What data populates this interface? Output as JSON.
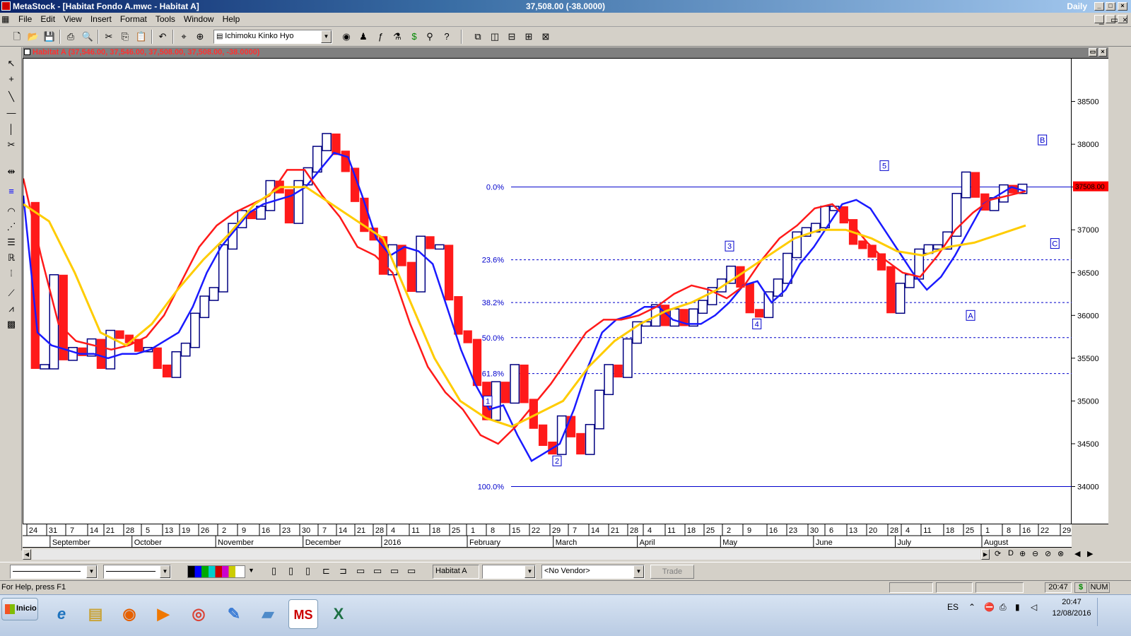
{
  "window": {
    "app_title": "MetaStock - [Habitat Fondo A.mwc - Habitat A]",
    "center_title": "37,508.00 (-38.0000)",
    "periodicity": "Daily"
  },
  "menu": [
    "File",
    "Edit",
    "View",
    "Insert",
    "Format",
    "Tools",
    "Window",
    "Help"
  ],
  "toolbar": {
    "indicator_combo": "Ichimoku Kinko Hyo"
  },
  "chart_header": "Habitat A (37,546.00, 37,546.00, 37,508.00, 37,508.00, -38.0000)",
  "chart_data": {
    "type": "bar",
    "security": "Habitat A",
    "last_price_label": "37508.00",
    "y_ticks": [
      34000,
      34500,
      35000,
      35500,
      36000,
      36500,
      37000,
      37500,
      38000,
      38500
    ],
    "fib_levels": [
      {
        "label": "0.0%",
        "value": 37500
      },
      {
        "label": "23.6%",
        "value": 36650
      },
      {
        "label": "38.2%",
        "value": 36150
      },
      {
        "label": "50.0%",
        "value": 35740
      },
      {
        "label": "61.8%",
        "value": 35320
      },
      {
        "label": "100.0%",
        "value": 34000
      }
    ],
    "wave_labels": [
      {
        "text": "1",
        "date": "2016-02-06",
        "value": 35000
      },
      {
        "text": "2",
        "date": "2016-02-29",
        "value": 34300
      },
      {
        "text": "3",
        "date": "2016-05-02",
        "value": 36810
      },
      {
        "text": "4",
        "date": "2016-05-11",
        "value": 35900
      },
      {
        "text": "5",
        "date": "2016-06-24",
        "value": 37750
      },
      {
        "text": "A",
        "date": "2016-07-25",
        "value": 36000
      },
      {
        "text": "B",
        "date": "2016-08-21",
        "value": 38050
      },
      {
        "text": "C",
        "date": "2016-08-25",
        "value": 36840
      }
    ],
    "x_day_ticks": [
      "24",
      "31",
      "7",
      "14",
      "21",
      "28",
      "5",
      "13",
      "19",
      "26",
      "2",
      "9",
      "16",
      "23",
      "30",
      "7",
      "14",
      "21",
      "28",
      "4",
      "11",
      "18",
      "25",
      "1",
      "8",
      "15",
      "22",
      "29",
      "7",
      "14",
      "21",
      "28",
      "4",
      "11",
      "18",
      "25",
      "2",
      "9",
      "16",
      "23",
      "30",
      "6",
      "13",
      "20",
      "28",
      "4",
      "11",
      "18",
      "25",
      "1",
      "8",
      "16",
      "22",
      "29"
    ],
    "x_month_ticks": [
      "September",
      "October",
      "November",
      "December",
      "2016",
      "February",
      "March",
      "April",
      "May",
      "June",
      "July",
      "August"
    ],
    "series": [
      {
        "name": "Price",
        "values": [
          37300,
          35400,
          35400,
          36450,
          35500,
          35600,
          35550,
          35700,
          35400,
          35800,
          35750,
          35700,
          35600,
          35600,
          35400,
          35300,
          35550,
          35650,
          36000,
          36200,
          36300,
          36800,
          37050,
          37200,
          37150,
          37250,
          37550,
          37450,
          37100,
          37550,
          37700,
          37950,
          38100,
          37900,
          37700,
          37350,
          37000,
          36900,
          36500,
          36800,
          36600,
          36300,
          36900,
          36800,
          36800,
          36200,
          35800,
          35700,
          35200,
          34800,
          35200,
          35000,
          35400,
          35000,
          34700,
          34500,
          34400,
          34800,
          34600,
          34400,
          34700,
          35100,
          35400,
          35300,
          35700,
          35900,
          35900,
          36100,
          35900,
          36050,
          35900,
          36050,
          36150,
          36300,
          36400,
          36550,
          36350,
          36050,
          36000,
          36250,
          36400,
          36700,
          36950,
          37000,
          37050,
          37250,
          37250,
          37100,
          36850,
          36800,
          36700,
          36550,
          36050,
          36350,
          36450,
          36750,
          36800,
          36800,
          36950,
          37400,
          37650,
          37400,
          37250,
          37350,
          37500,
          37450,
          37508
        ]
      },
      {
        "name": "MA Blue",
        "values": [
          37400,
          35800,
          35650,
          35600,
          35550,
          35550,
          35500,
          35550,
          35550,
          35600,
          35700,
          35800,
          36100,
          36500,
          36800,
          37000,
          37200,
          37300,
          37350,
          37400,
          37500,
          37700,
          37900,
          37850,
          37400,
          36900,
          36700,
          36800,
          36750,
          36600,
          36100,
          35600,
          35200,
          34900,
          34950,
          34600,
          34300,
          34400,
          34500,
          34900,
          35400,
          35800,
          35950,
          36000,
          36100,
          36100,
          35950,
          35900,
          35900,
          36000,
          36150,
          36350,
          36400,
          36150,
          36300,
          36600,
          36800,
          37050,
          37300,
          37350,
          37250,
          37000,
          36750,
          36500,
          36300,
          36450,
          36700,
          37000,
          37300,
          37400,
          37500,
          37450
        ]
      },
      {
        "name": "MA Red",
        "values": [
          37600,
          36700,
          35900,
          35700,
          35650,
          35600,
          35650,
          35750,
          36000,
          36400,
          36800,
          37050,
          37200,
          37300,
          37400,
          37700,
          37700,
          37400,
          37150,
          36800,
          36700,
          36500,
          35900,
          35400,
          35100,
          34900,
          34600,
          34500,
          34700,
          34950,
          35200,
          35500,
          35800,
          35950,
          35950,
          36000,
          36100,
          36250,
          36350,
          36300,
          36200,
          36350,
          36650,
          36900,
          37050,
          37250,
          37300,
          37100,
          36850,
          36650,
          36500,
          36450,
          36700,
          37000,
          37200,
          37350,
          37400,
          37450
        ]
      },
      {
        "name": "MA Yellow",
        "values": [
          37300,
          37100,
          36500,
          35800,
          35650,
          35900,
          36300,
          36650,
          36950,
          37300,
          37500,
          37500,
          37300,
          37100,
          36900,
          36200,
          35500,
          35000,
          34800,
          34700,
          34850,
          35000,
          35400,
          35700,
          35900,
          36050,
          36150,
          36300,
          36500,
          36700,
          36900,
          37000,
          37000,
          36900,
          36750,
          36700,
          36800,
          36850,
          36950,
          37050
        ]
      }
    ]
  },
  "bottom": {
    "security_box": "Habitat A",
    "vendor": "<No Vendor>",
    "trade_button": "Trade"
  },
  "status": {
    "help": "For Help, press F1",
    "time": "20:47",
    "dollar": "$",
    "num": "NUM"
  },
  "taskbar": {
    "start": "Inicio",
    "lang": "ES",
    "clock_time": "20:47",
    "clock_date": "12/08/2016"
  }
}
